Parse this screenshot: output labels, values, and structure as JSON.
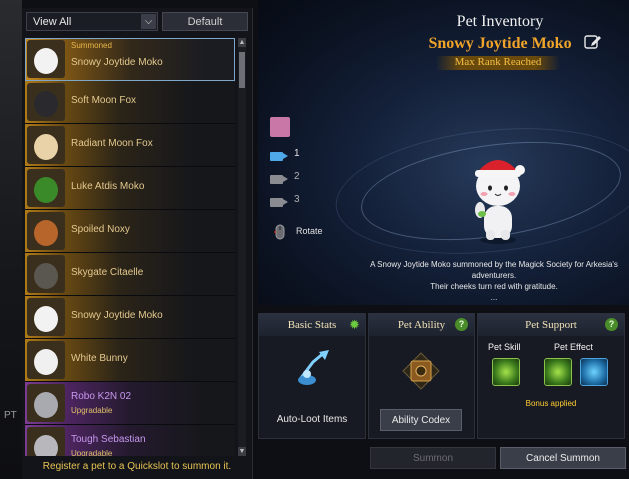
{
  "window": {
    "side_label": "PT"
  },
  "list": {
    "filter_value": "View All",
    "default_label": "Default",
    "pets": [
      {
        "tag": "Summoned",
        "name": "Snowy Joytide Moko",
        "style": "sel"
      },
      {
        "name": "Soft Moon Fox"
      },
      {
        "name": "Radiant Moon Fox"
      },
      {
        "name": "Luke Atdis Moko"
      },
      {
        "name": "Spoiled Noxy"
      },
      {
        "name": "Skygate Citaelle"
      },
      {
        "name": "Snowy Joytide Moko"
      },
      {
        "name": "White Bunny"
      },
      {
        "name": "Robo K2N 02",
        "status": "Upgradable",
        "style": "purple"
      },
      {
        "name": "Tough Sebastian",
        "status": "Upgradable",
        "style": "purple"
      }
    ],
    "hint": "Register a pet to a Quickslot to summon it."
  },
  "header": {
    "title": "Pet Inventory",
    "pet_name": "Snowy Joytide Moko",
    "rank": "Max Rank Reached"
  },
  "view_tools": {
    "cameras": [
      "1",
      "2",
      "3"
    ],
    "rotate_label": "Rotate"
  },
  "description": {
    "line1": "A Snowy Joytide Moko summoned by the Magick Society for Arkesia's",
    "line2": "adventurers.",
    "line3": "Their cheeks turn red with gratitude.",
    "line4": "..."
  },
  "panels": {
    "basic_stats": {
      "title": "Basic Stats",
      "item": "Auto-Loot Items"
    },
    "pet_ability": {
      "title": "Pet Ability",
      "codex_label": "Ability Codex"
    },
    "pet_support": {
      "title": "Pet Support",
      "skill_label": "Pet Skill",
      "effect_label": "Pet Effect",
      "bonus": "Bonus applied"
    }
  },
  "actions": {
    "summon": "Summon",
    "cancel_summon": "Cancel Summon"
  },
  "colors": {
    "accent_gold": "#f1a42a",
    "rank_gold": "#f5c044",
    "hint_yellow": "#e8c454",
    "upgrade_purple": "#c798ef"
  }
}
